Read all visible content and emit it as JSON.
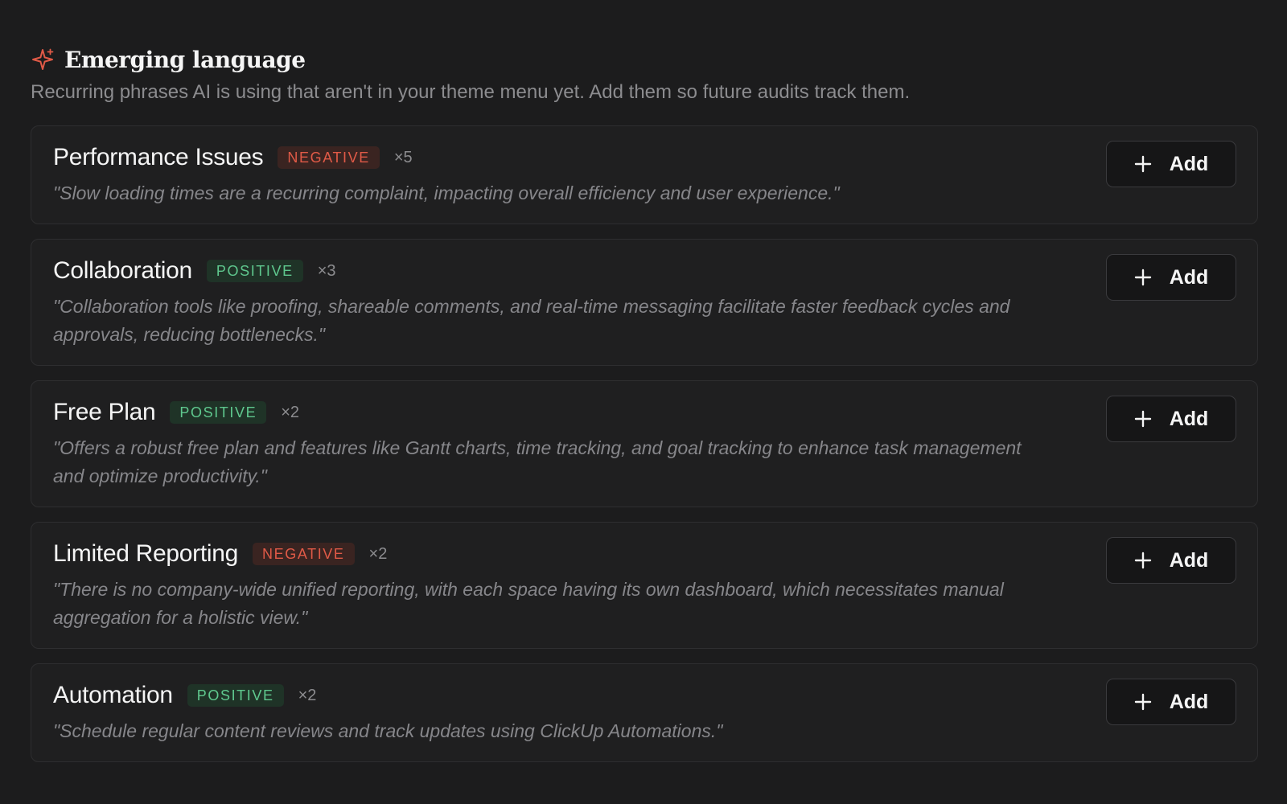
{
  "section": {
    "icon": "sparkle-icon",
    "title": "Emerging language",
    "subtitle": "Recurring phrases AI is using that aren't in your theme menu yet. Add them so future audits track them."
  },
  "colors": {
    "accent": "#e05a47",
    "negative": "#e05a47",
    "positive": "#5fc88e",
    "background": "#1c1c1d"
  },
  "items": [
    {
      "name": "Performance Issues",
      "sentiment": "NEGATIVE",
      "count": "×5",
      "quote": "\"Slow loading times are a recurring complaint, impacting overall efficiency and user experience.\"",
      "add_label": "Add"
    },
    {
      "name": "Collaboration",
      "sentiment": "POSITIVE",
      "count": "×3",
      "quote": "\"Collaboration tools like proofing, shareable comments, and real-time messaging facilitate faster feedback cycles and approvals, reducing bottlenecks.\"",
      "add_label": "Add"
    },
    {
      "name": "Free Plan",
      "sentiment": "POSITIVE",
      "count": "×2",
      "quote": "\"Offers a robust free plan and features like Gantt charts, time tracking, and goal tracking to enhance task management and optimize productivity.\"",
      "add_label": "Add"
    },
    {
      "name": "Limited Reporting",
      "sentiment": "NEGATIVE",
      "count": "×2",
      "quote": "\"There is no company-wide unified reporting, with each space having its own dashboard, which necessitates manual aggregation for a holistic view.\"",
      "add_label": "Add"
    },
    {
      "name": "Automation",
      "sentiment": "POSITIVE",
      "count": "×2",
      "quote": "\"Schedule regular content reviews and track updates using ClickUp Automations.\"",
      "add_label": "Add"
    }
  ]
}
